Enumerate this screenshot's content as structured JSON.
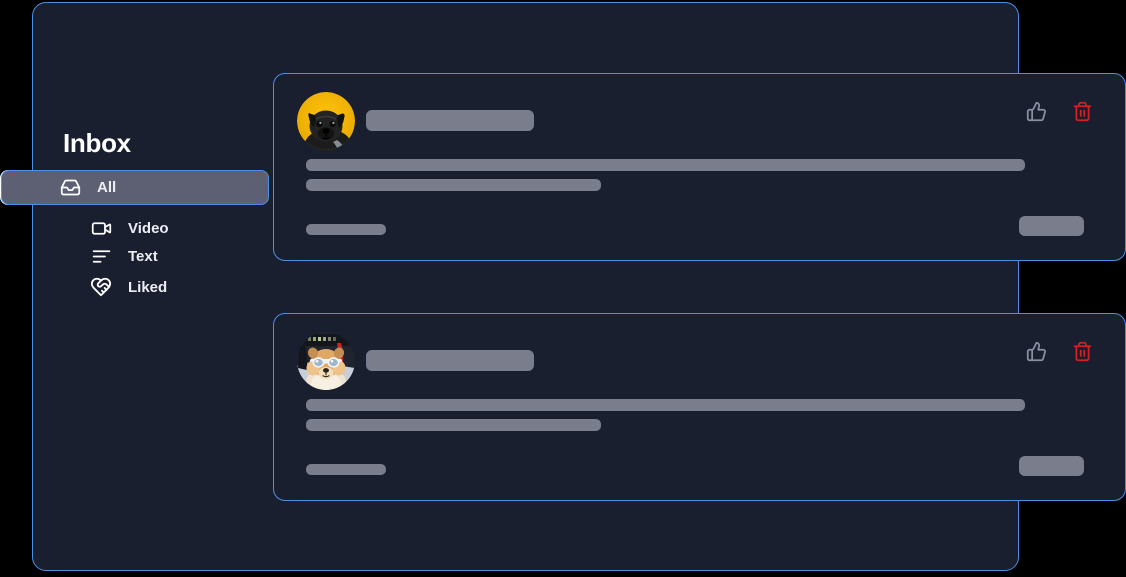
{
  "app": {
    "background_color": "#000000",
    "panel_color": "#1a1f30",
    "border_color": "#4a8fe8",
    "skeleton_color": "#797d8c",
    "active_item_color": "#5c6072",
    "delete_color": "#d32020",
    "like_color": "#8a8fa3"
  },
  "sidebar": {
    "title": "Inbox",
    "items": [
      {
        "label": "All",
        "icon": "inbox-icon",
        "active": true
      },
      {
        "label": "Video",
        "icon": "video-icon",
        "active": false
      },
      {
        "label": "Text",
        "icon": "text-lines-icon",
        "active": false
      },
      {
        "label": "Liked",
        "icon": "heart-handshake-icon",
        "active": false
      }
    ]
  },
  "feed": {
    "cards": [
      {
        "avatar": "black-pug-on-yellow-avatar",
        "name_placeholder": "",
        "body_line_1_placeholder": "",
        "body_line_2_placeholder": "",
        "meta_placeholder": "",
        "button_placeholder": "",
        "actions": [
          {
            "label": "",
            "icon": "thumbs-up-icon"
          },
          {
            "label": "",
            "icon": "trash-icon"
          }
        ]
      },
      {
        "avatar": "chow-chow-with-sunglasses-avatar",
        "name_placeholder": "",
        "body_line_1_placeholder": "",
        "body_line_2_placeholder": "",
        "meta_placeholder": "",
        "button_placeholder": "",
        "actions": [
          {
            "label": "",
            "icon": "thumbs-up-icon"
          },
          {
            "label": "",
            "icon": "trash-icon"
          }
        ]
      }
    ]
  }
}
